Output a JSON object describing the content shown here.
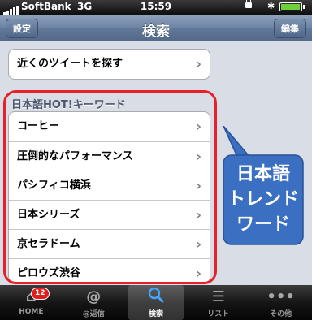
{
  "status_bar": {
    "carrier": "SoftBank",
    "network": "3G",
    "time": "15:59",
    "bluetooth_icon": "bluetooth-icon",
    "battery_color": "#6fd13a"
  },
  "nav_bar": {
    "left_button": "設定",
    "title": "検索",
    "right_button": "編集"
  },
  "search_row": {
    "label": "近くのツイートを探す"
  },
  "trending_section": {
    "title": "日本語HOT!キーワード",
    "items": [
      "コーヒー",
      "圧倒的なパフォーマンス",
      "パシフィコ横浜",
      "日本シリーズ",
      "京セラドーム",
      "ピロウズ渋谷"
    ]
  },
  "callout": {
    "lines": [
      "日本語",
      "トレンド",
      "ワード"
    ],
    "color": "#3b6fc2",
    "highlight_color": "#e8202a"
  },
  "tab_bar": {
    "tabs": [
      {
        "label": "HOME",
        "icon": "home-icon",
        "badge": "12"
      },
      {
        "label": "@返信",
        "icon": "at-icon"
      },
      {
        "label": "検索",
        "icon": "search-icon",
        "active": true
      },
      {
        "label": "リスト",
        "icon": "list-icon"
      },
      {
        "label": "その他",
        "icon": "more-icon"
      }
    ]
  }
}
